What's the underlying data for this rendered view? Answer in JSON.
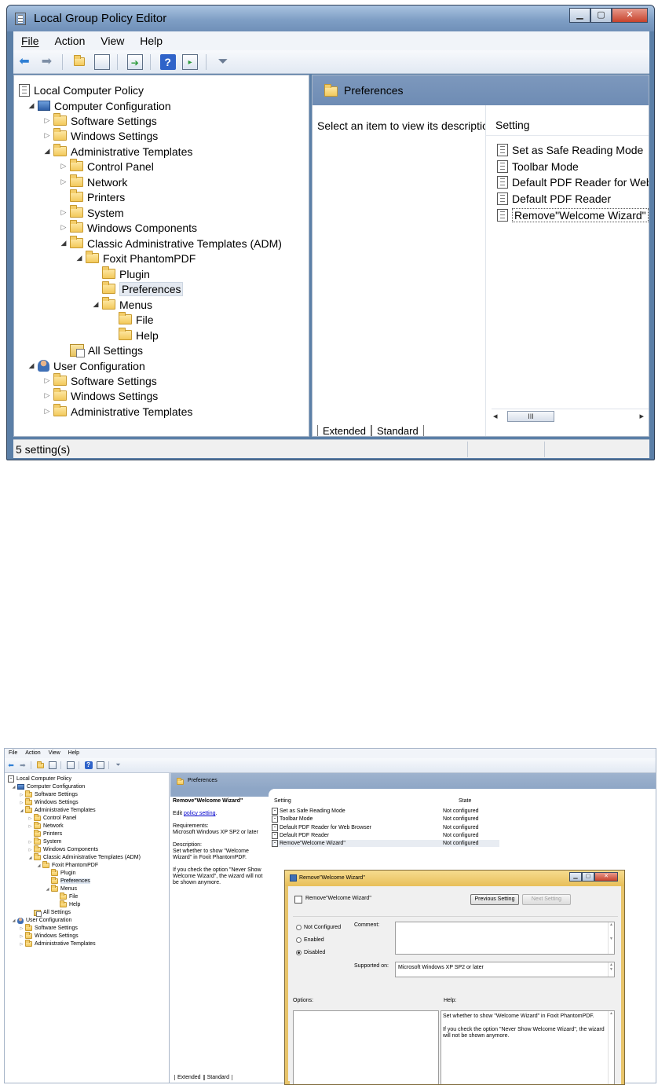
{
  "window1": {
    "title": "Local Group Policy Editor",
    "menu": [
      "File",
      "Action",
      "View",
      "Help"
    ],
    "tree": [
      {
        "label": "Local Computer Policy"
      },
      {
        "label": "Computer Configuration"
      },
      {
        "label": "Software Settings"
      },
      {
        "label": "Windows Settings"
      },
      {
        "label": "Administrative Templates"
      },
      {
        "label": "Control Panel"
      },
      {
        "label": "Network"
      },
      {
        "label": "Printers"
      },
      {
        "label": "System"
      },
      {
        "label": "Windows Components"
      },
      {
        "label": "Classic Administrative Templates (ADM)"
      },
      {
        "label": "Foxit PhantomPDF"
      },
      {
        "label": "Plugin"
      },
      {
        "label": "Preferences"
      },
      {
        "label": "Menus"
      },
      {
        "label": "File"
      },
      {
        "label": "Help"
      },
      {
        "label": "All Settings"
      },
      {
        "label": "User Configuration"
      },
      {
        "label": "Software Settings"
      },
      {
        "label": "Windows Settings"
      },
      {
        "label": "Administrative Templates"
      }
    ],
    "right": {
      "header": "Preferences",
      "description": "Select an item to view its description.",
      "column_setting": "Setting",
      "items": [
        "Set as Safe Reading Mode",
        "Toolbar Mode",
        "Default PDF Reader for Web Brov",
        "Default PDF Reader",
        "Remove\"Welcome Wizard\""
      ],
      "scroll_thumb": "III"
    },
    "tabs": [
      "Extended",
      "Standard"
    ],
    "status": "5 setting(s)"
  },
  "window2": {
    "menu": [
      "File",
      "Action",
      "View",
      "Help"
    ],
    "tree": [
      "Local Computer Policy",
      "Computer Configuration",
      "Software Settings",
      "Windows Settings",
      "Administrative Templates",
      "Control Panel",
      "Network",
      "Printers",
      "System",
      "Windows Components",
      "Classic Administrative Templates (ADM)",
      "Foxit PhantomPDF",
      "Plugin",
      "Preferences",
      "Menus",
      "File",
      "Help",
      "All Settings",
      "User Configuration",
      "Software Settings",
      "Windows Settings",
      "Administrative Templates"
    ],
    "header": "Preferences",
    "extended": {
      "title": "Remove\"Welcome Wizard\"",
      "edit_prefix": "Edit ",
      "edit_link": "policy setting",
      "edit_suffix": ".",
      "req_label": "Requirements:",
      "req_value": "Microsoft Windows XP SP2 or later",
      "desc_label": "Description:",
      "desc_1": "Set whether to show \"Welcome Wizard\" in Foxit PhantomPDF.",
      "desc_2": "If you check the option \"Never Show Welcome Wizard\", the wizard will not be shown anymore."
    },
    "list": {
      "col_setting": "Setting",
      "col_state": "State",
      "rows": [
        {
          "name": "Set as Safe Reading Mode",
          "state": "Not configured"
        },
        {
          "name": "Toolbar Mode",
          "state": "Not configured"
        },
        {
          "name": "Default PDF Reader for Web Browser",
          "state": "Not configured"
        },
        {
          "name": "Default PDF Reader",
          "state": "Not configured"
        },
        {
          "name": "Remove\"Welcome Wizard\"",
          "state": "Not configured"
        }
      ]
    },
    "tabs": [
      "Extended",
      "Standard"
    ]
  },
  "dialog": {
    "title": "Remove\"Welcome Wizard\"",
    "header": "Remove\"Welcome Wizard\"",
    "prev_button": "Previous Setting",
    "next_button": "Next Setting",
    "radio_not_configured": "Not Configured",
    "radio_enabled": "Enabled",
    "radio_disabled": "Disabled",
    "selected": "Disabled",
    "comment_label": "Comment:",
    "supported_label": "Supported on:",
    "supported_value": "Microsoft Windows XP SP2 or later",
    "options_label": "Options:",
    "help_label": "Help:",
    "help_1": "Set whether to show \"Welcome Wizard\" in Foxit PhantomPDF.",
    "help_2": "If you check the option \"Never Show Welcome Wizard\", the wizard will not be shown anymore."
  }
}
